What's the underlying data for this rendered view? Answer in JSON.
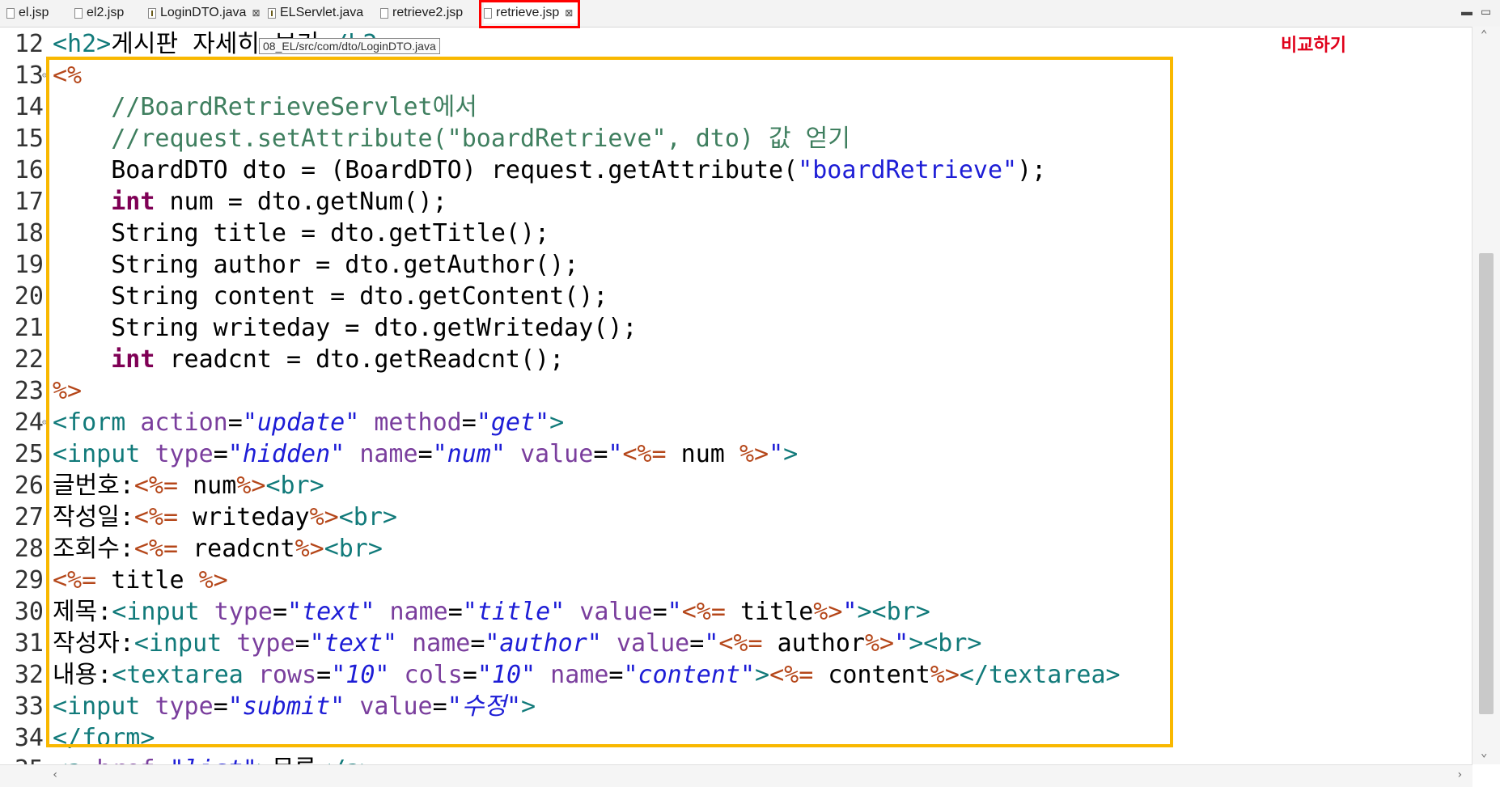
{
  "tabs": [
    {
      "label": "el.jsp",
      "icon": "jsp-file-icon"
    },
    {
      "label": "el2.jsp",
      "icon": "jsp-file-icon"
    },
    {
      "label": "LoginDTO.java",
      "icon": "java-file-icon",
      "close": "⊠"
    },
    {
      "label": "ELServlet.java",
      "icon": "java-file-icon"
    },
    {
      "label": "retrieve2.jsp",
      "icon": "jsp-file-icon"
    },
    {
      "label": "retrieve.jsp",
      "icon": "jsp-file-icon",
      "close": "⊠"
    }
  ],
  "window_controls": {
    "minimize": "▬",
    "maximize": "▭"
  },
  "tooltip": "08_EL/src/com/dto/LoginDTO.java",
  "annotation": "비교하기",
  "colors": {
    "highlight_tab_border": "#ff0000",
    "code_block_border": "#f9b800",
    "annotation": "#e0001a"
  },
  "lines": [
    {
      "n": "12",
      "fold": "",
      "t": [
        [
          "tag",
          "<h2>"
        ],
        [
          "text",
          "게시판 자세히 보기"
        ],
        [
          "tag",
          "</h2>"
        ]
      ]
    },
    {
      "n": "13",
      "fold": "⊖",
      "t": [
        [
          "jsp",
          "<%"
        ]
      ]
    },
    {
      "n": "14",
      "fold": "",
      "t": [
        [
          "text",
          "    "
        ],
        [
          "com",
          "//BoardRetrieveServlet에서"
        ]
      ]
    },
    {
      "n": "15",
      "fold": "",
      "t": [
        [
          "text",
          "    "
        ],
        [
          "com",
          "//request.setAttribute(\"boardRetrieve\", dto) 값 얻기"
        ]
      ]
    },
    {
      "n": "16",
      "fold": "",
      "t": [
        [
          "text",
          "    BoardDTO dto = (BoardDTO) request.getAttribute("
        ],
        [
          "jstr",
          "\"boardRetrieve\""
        ],
        [
          "text",
          ");"
        ]
      ]
    },
    {
      "n": "17",
      "fold": "",
      "t": [
        [
          "text",
          "    "
        ],
        [
          "kw",
          "int"
        ],
        [
          "text",
          " num = dto.getNum();"
        ]
      ]
    },
    {
      "n": "18",
      "fold": "",
      "t": [
        [
          "text",
          "    String title = dto.getTitle();"
        ]
      ]
    },
    {
      "n": "19",
      "fold": "",
      "t": [
        [
          "text",
          "    String author = dto.getAuthor();"
        ]
      ]
    },
    {
      "n": "20",
      "fold": "",
      "t": [
        [
          "text",
          "    String content = dto.getContent();"
        ]
      ]
    },
    {
      "n": "21",
      "fold": "",
      "t": [
        [
          "text",
          "    String writeday = dto.getWriteday();"
        ]
      ]
    },
    {
      "n": "22",
      "fold": "",
      "t": [
        [
          "text",
          "    "
        ],
        [
          "kw",
          "int"
        ],
        [
          "text",
          " readcnt = dto.getReadcnt();"
        ]
      ]
    },
    {
      "n": "23",
      "fold": "",
      "t": [
        [
          "jsp",
          "%>"
        ]
      ]
    },
    {
      "n": "24",
      "fold": "⊖",
      "t": [
        [
          "tag",
          "<form "
        ],
        [
          "attr",
          "action"
        ],
        [
          "text",
          "="
        ],
        [
          "str",
          "\"update\""
        ],
        [
          "text",
          " "
        ],
        [
          "attr",
          "method"
        ],
        [
          "text",
          "="
        ],
        [
          "str",
          "\"get\""
        ],
        [
          "tag",
          ">"
        ]
      ]
    },
    {
      "n": "25",
      "fold": "",
      "t": [
        [
          "tag",
          "<input "
        ],
        [
          "attr",
          "type"
        ],
        [
          "text",
          "="
        ],
        [
          "str",
          "\"hidden\""
        ],
        [
          "text",
          " "
        ],
        [
          "attr",
          "name"
        ],
        [
          "text",
          "="
        ],
        [
          "str",
          "\"num\""
        ],
        [
          "text",
          " "
        ],
        [
          "attr",
          "value"
        ],
        [
          "text",
          "="
        ],
        [
          "jstr",
          "\""
        ],
        [
          "jsp",
          "<%="
        ],
        [
          "text",
          " num "
        ],
        [
          "jsp",
          "%>"
        ],
        [
          "jstr",
          "\""
        ],
        [
          "tag",
          ">"
        ]
      ]
    },
    {
      "n": "26",
      "fold": "",
      "t": [
        [
          "text",
          "글번호:"
        ],
        [
          "jsp",
          "<%="
        ],
        [
          "text",
          " num"
        ],
        [
          "jsp",
          "%>"
        ],
        [
          "tag",
          "<br>"
        ]
      ]
    },
    {
      "n": "27",
      "fold": "",
      "t": [
        [
          "text",
          "작성일:"
        ],
        [
          "jsp",
          "<%="
        ],
        [
          "text",
          " writeday"
        ],
        [
          "jsp",
          "%>"
        ],
        [
          "tag",
          "<br>"
        ]
      ]
    },
    {
      "n": "28",
      "fold": "",
      "t": [
        [
          "text",
          "조회수:"
        ],
        [
          "jsp",
          "<%="
        ],
        [
          "text",
          " readcnt"
        ],
        [
          "jsp",
          "%>"
        ],
        [
          "tag",
          "<br>"
        ]
      ]
    },
    {
      "n": "29",
      "fold": "",
      "t": [
        [
          "jsp",
          "<%="
        ],
        [
          "text",
          " title "
        ],
        [
          "jsp",
          "%>"
        ]
      ]
    },
    {
      "n": "30",
      "fold": "",
      "t": [
        [
          "text",
          "제목:"
        ],
        [
          "tag",
          "<input "
        ],
        [
          "attr",
          "type"
        ],
        [
          "text",
          "="
        ],
        [
          "str",
          "\"text\""
        ],
        [
          "text",
          " "
        ],
        [
          "attr",
          "name"
        ],
        [
          "text",
          "="
        ],
        [
          "str",
          "\"title\""
        ],
        [
          "text",
          " "
        ],
        [
          "attr",
          "value"
        ],
        [
          "text",
          "="
        ],
        [
          "jstr",
          "\""
        ],
        [
          "jsp",
          "<%="
        ],
        [
          "text",
          " title"
        ],
        [
          "jsp",
          "%>"
        ],
        [
          "jstr",
          "\""
        ],
        [
          "tag",
          ">"
        ],
        [
          "tag",
          "<br>"
        ]
      ]
    },
    {
      "n": "31",
      "fold": "",
      "t": [
        [
          "text",
          "작성자:"
        ],
        [
          "tag",
          "<input "
        ],
        [
          "attr",
          "type"
        ],
        [
          "text",
          "="
        ],
        [
          "str",
          "\"text\""
        ],
        [
          "text",
          " "
        ],
        [
          "attr",
          "name"
        ],
        [
          "text",
          "="
        ],
        [
          "str",
          "\"author\""
        ],
        [
          "text",
          " "
        ],
        [
          "attr",
          "value"
        ],
        [
          "text",
          "="
        ],
        [
          "jstr",
          "\""
        ],
        [
          "jsp",
          "<%="
        ],
        [
          "text",
          " author"
        ],
        [
          "jsp",
          "%>"
        ],
        [
          "jstr",
          "\""
        ],
        [
          "tag",
          ">"
        ],
        [
          "tag",
          "<br>"
        ]
      ]
    },
    {
      "n": "32",
      "fold": "",
      "t": [
        [
          "text",
          "내용:"
        ],
        [
          "tag",
          "<textarea "
        ],
        [
          "attr",
          "rows"
        ],
        [
          "text",
          "="
        ],
        [
          "str",
          "\"10\""
        ],
        [
          "text",
          " "
        ],
        [
          "attr",
          "cols"
        ],
        [
          "text",
          "="
        ],
        [
          "str",
          "\"10\""
        ],
        [
          "text",
          " "
        ],
        [
          "attr",
          "name"
        ],
        [
          "text",
          "="
        ],
        [
          "str",
          "\"content\""
        ],
        [
          "tag",
          ">"
        ],
        [
          "jsp",
          "<%="
        ],
        [
          "text",
          " content"
        ],
        [
          "jsp",
          "%>"
        ],
        [
          "tag",
          "</textarea>"
        ]
      ]
    },
    {
      "n": "33",
      "fold": "",
      "t": [
        [
          "tag",
          "<input "
        ],
        [
          "attr",
          "type"
        ],
        [
          "text",
          "="
        ],
        [
          "str",
          "\"submit\""
        ],
        [
          "text",
          " "
        ],
        [
          "attr",
          "value"
        ],
        [
          "text",
          "="
        ],
        [
          "str",
          "\"수정\""
        ],
        [
          "tag",
          ">"
        ]
      ]
    },
    {
      "n": "34",
      "fold": "",
      "t": [
        [
          "tag",
          "</form>"
        ]
      ]
    },
    {
      "n": "35",
      "fold": "",
      "t": [
        [
          "tag",
          "<a "
        ],
        [
          "attr",
          "href"
        ],
        [
          "text",
          "="
        ],
        [
          "str",
          "\"list\""
        ],
        [
          "tag",
          ">"
        ],
        [
          "text",
          "목록"
        ],
        [
          "tag",
          "</a>"
        ]
      ]
    }
  ]
}
